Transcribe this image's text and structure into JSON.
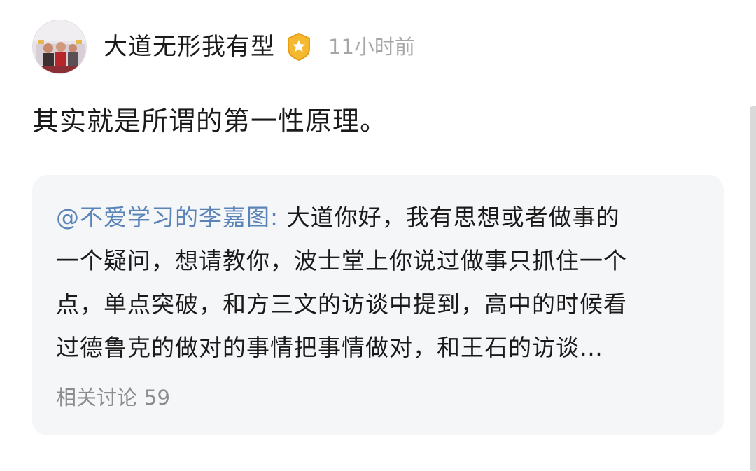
{
  "post": {
    "author": {
      "name": "大道无形我有型",
      "avatar_icon": "avatar-photo",
      "badge_icon": "gold-star-badge-icon"
    },
    "time": "11小时前",
    "content": "其实就是所谓的第一性原理。"
  },
  "quote": {
    "mention": "@不爱学习的李嘉图:",
    "lines": [
      " 大道你好，我有思想或者做事的",
      "一个疑问，想请教你，波士堂上你说过做事只抓住一个",
      "点，单点突破，和方三文的访谈中提到，高中的时候看",
      "过德鲁克的做对的事情把事情做对，和王石的访谈…"
    ],
    "related_label": "相关讨论",
    "related_count": "59"
  },
  "colors": {
    "mention": "#5a84b8",
    "card_bg": "#f5f6f8",
    "time": "#a6a6a6",
    "badge_gold": "#f5b82e"
  }
}
